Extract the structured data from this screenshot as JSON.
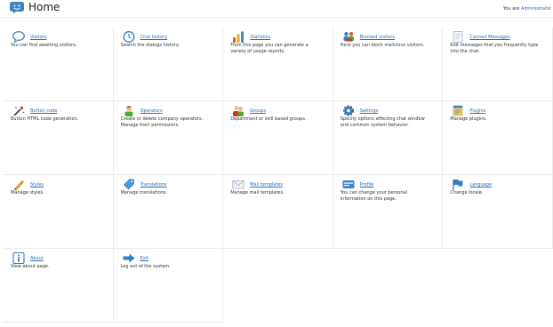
{
  "header": {
    "title": "Home",
    "user_prefix": "You are",
    "user_name": "Administrator"
  },
  "colors": {
    "link": "#2b6db5",
    "grid_line": "#ececec"
  },
  "menu": [
    {
      "label": "Visitors",
      "desc": "You can find awaiting visitors.",
      "icon": "chat-bubble-icon"
    },
    {
      "label": "Chat history",
      "desc": "Search the dialogs history.",
      "icon": "clock-icon"
    },
    {
      "label": "Statistics",
      "desc": "From this page you can generate a variety of usage reports.",
      "icon": "bar-chart-icon"
    },
    {
      "label": "Blocked visitors",
      "desc": "Here you can block malicious visitors.",
      "icon": "blocked-users-icon"
    },
    {
      "label": "Canned Messages",
      "desc": "Edit messages that you frequently type into the chat.",
      "icon": "document-icon"
    },
    {
      "label": "Button code",
      "desc": "Button HTML code generation.",
      "icon": "magic-wand-icon"
    },
    {
      "label": "Operators",
      "desc": "Create or delete company operators. Manage their permissions.",
      "icon": "operator-icon"
    },
    {
      "label": "Groups",
      "desc": "Department or skill based groups.",
      "icon": "group-icon"
    },
    {
      "label": "Settings",
      "desc": "Specify options affecting chat window and common system behavior.",
      "icon": "gear-icon"
    },
    {
      "label": "Plugins",
      "desc": "Manage plugins.",
      "icon": "plugin-icon"
    },
    {
      "label": "Styles",
      "desc": "Manage styles.",
      "icon": "pencil-icon"
    },
    {
      "label": "Translations",
      "desc": "Manage translations.",
      "icon": "tag-icon"
    },
    {
      "label": "Mail templates",
      "desc": "Manage mail templates.",
      "icon": "envelope-icon"
    },
    {
      "label": "Profile",
      "desc": "You can change your personal information on this page.",
      "icon": "id-card-icon"
    },
    {
      "label": "Language",
      "desc": "Change locale.",
      "icon": "flag-icon"
    },
    {
      "label": "About",
      "desc": "View about page.",
      "icon": "info-icon"
    },
    {
      "label": "Exit",
      "desc": "Log out of the system.",
      "icon": "exit-arrow-icon"
    }
  ]
}
